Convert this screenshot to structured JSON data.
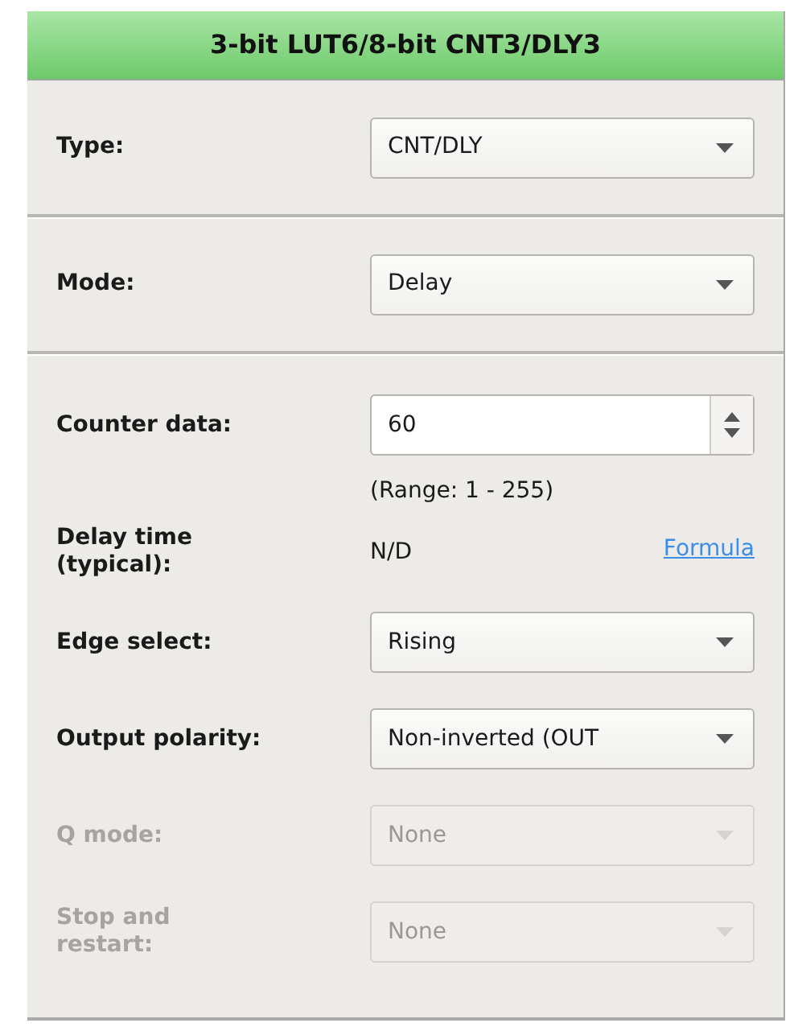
{
  "panel": {
    "title": "3-bit LUT6/8-bit CNT3/DLY3"
  },
  "sections": [
    {
      "rows": [
        {
          "kind": "select",
          "label": "Type:",
          "value": "CNT/DLY",
          "disabled": false
        }
      ]
    },
    {
      "rows": [
        {
          "kind": "select",
          "label": "Mode:",
          "value": "Delay",
          "disabled": false
        }
      ]
    },
    {
      "rows": [
        {
          "kind": "spin",
          "label": "Counter data:",
          "value": "60",
          "note": "(Range:  1 - 255)"
        },
        {
          "kind": "readout",
          "label": "Delay time (typical):",
          "value": "N/D",
          "link": "Formula"
        },
        {
          "kind": "select",
          "label": "Edge select:",
          "value": "Rising",
          "disabled": false
        },
        {
          "kind": "select",
          "label": "Output polarity:",
          "value": "Non-inverted (OUT",
          "disabled": false
        },
        {
          "kind": "select",
          "label": "Q mode:",
          "value": "None",
          "disabled": true
        },
        {
          "kind": "select",
          "label": "Stop and restart:",
          "value": "None",
          "disabled": true
        }
      ]
    }
  ]
}
